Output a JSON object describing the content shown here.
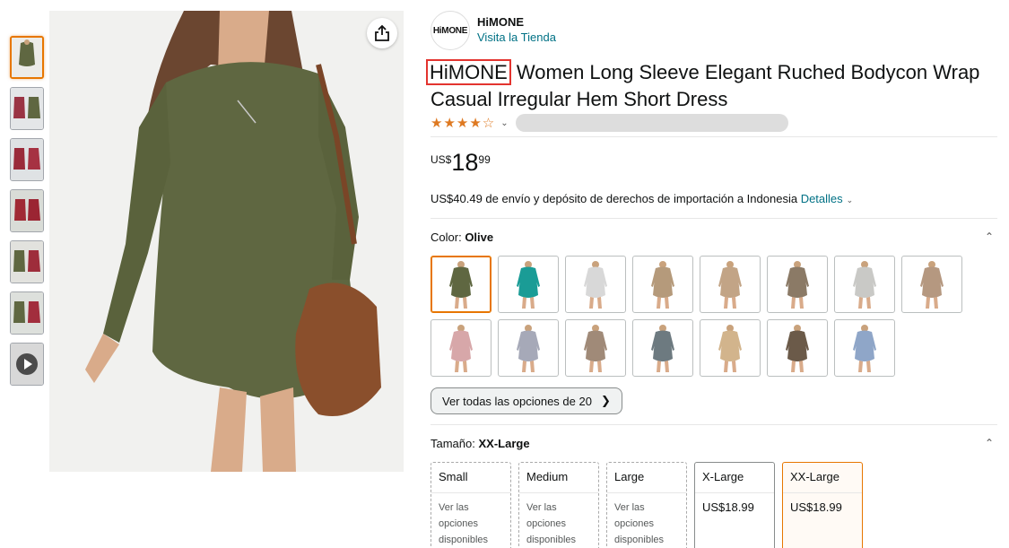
{
  "brand": {
    "logo_text": "HiMONE",
    "name": "HiMONE",
    "store_link": "Visita la Tienda"
  },
  "title": {
    "brand_part": "HiMONE",
    "rest": "Women Long Sleeve Elegant Ruched Bodycon Wrap Casual Irregular Hem Short Dress"
  },
  "rating": {
    "stars_text": "★★★★☆",
    "value": 4.5
  },
  "price": {
    "currency": "US$",
    "whole": "18",
    "fraction": "99"
  },
  "shipping": {
    "text": "US$40.49 de envío y depósito de derechos de importación a Indonesia",
    "link": "Detalles"
  },
  "color": {
    "label": "Color:",
    "selected": "Olive",
    "see_all": "Ver todas las opciones de 20",
    "swatch_colors": [
      "#5f6741",
      "#1a9c96",
      "#d8d8d8",
      "#b59a7b",
      "#c2a486",
      "#8b7a66",
      "#c9c9c6",
      "#b59880",
      "#d7a7a9",
      "#a6a9b8",
      "#a08a78",
      "#6d7a80",
      "#d2b48c",
      "#6b5a49",
      "#8fa6c8"
    ]
  },
  "size": {
    "label": "Tamaño:",
    "selected": "XX-Large",
    "options": [
      {
        "name": "Small",
        "body": "Ver las opciones disponibles"
      },
      {
        "name": "Medium",
        "body": "Ver las opciones disponibles"
      },
      {
        "name": "Large",
        "body": "Ver las opciones disponibles"
      },
      {
        "name": "X-Large",
        "body": "US$18.99"
      },
      {
        "name": "XX-Large",
        "body": "US$18.99"
      }
    ]
  },
  "colors": {
    "accent": "#e77600",
    "link": "#007185",
    "star": "#de7921",
    "highlight_box": "#e3342f"
  }
}
